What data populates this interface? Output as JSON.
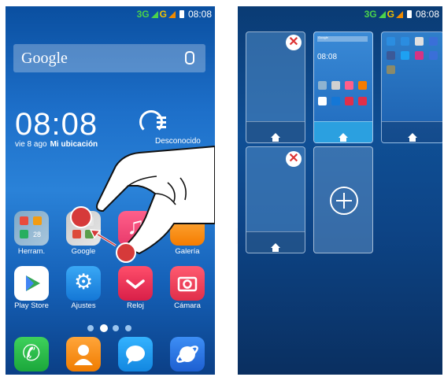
{
  "status_bar": {
    "network": "3G",
    "network2": "G",
    "time": "08:08"
  },
  "search": {
    "brand": "Google"
  },
  "clock": {
    "time": "08:08",
    "date": "vie 8 ago",
    "location": "Mi ubicación"
  },
  "weather": {
    "text": "Desconocido"
  },
  "apps_row1": [
    {
      "label": "Herram.",
      "icon": "folder-icon"
    },
    {
      "label": "Google",
      "icon": "google-folder-icon"
    },
    {
      "label": "",
      "icon": "music-icon"
    },
    {
      "label": "Galería",
      "icon": "gallery-icon"
    }
  ],
  "apps_row2": [
    {
      "label": "Play Store",
      "icon": "play-store-icon"
    },
    {
      "label": "Ajustes",
      "icon": "gear-icon"
    },
    {
      "label": "Reloj",
      "icon": "clock-icon"
    },
    {
      "label": "Cámara",
      "icon": "camera-icon"
    }
  ],
  "folder_badge": "28",
  "dock": [
    "phone-icon",
    "contacts-icon",
    "messages-icon",
    "browser-icon"
  ],
  "right_status": {
    "network": "3G",
    "network2": "G",
    "time": "08:08"
  },
  "preview": {
    "time": "08:08",
    "brand": "Google"
  },
  "colors": {
    "accent_red": "#d63a3a",
    "wallpaper": "#1d6fc9"
  }
}
